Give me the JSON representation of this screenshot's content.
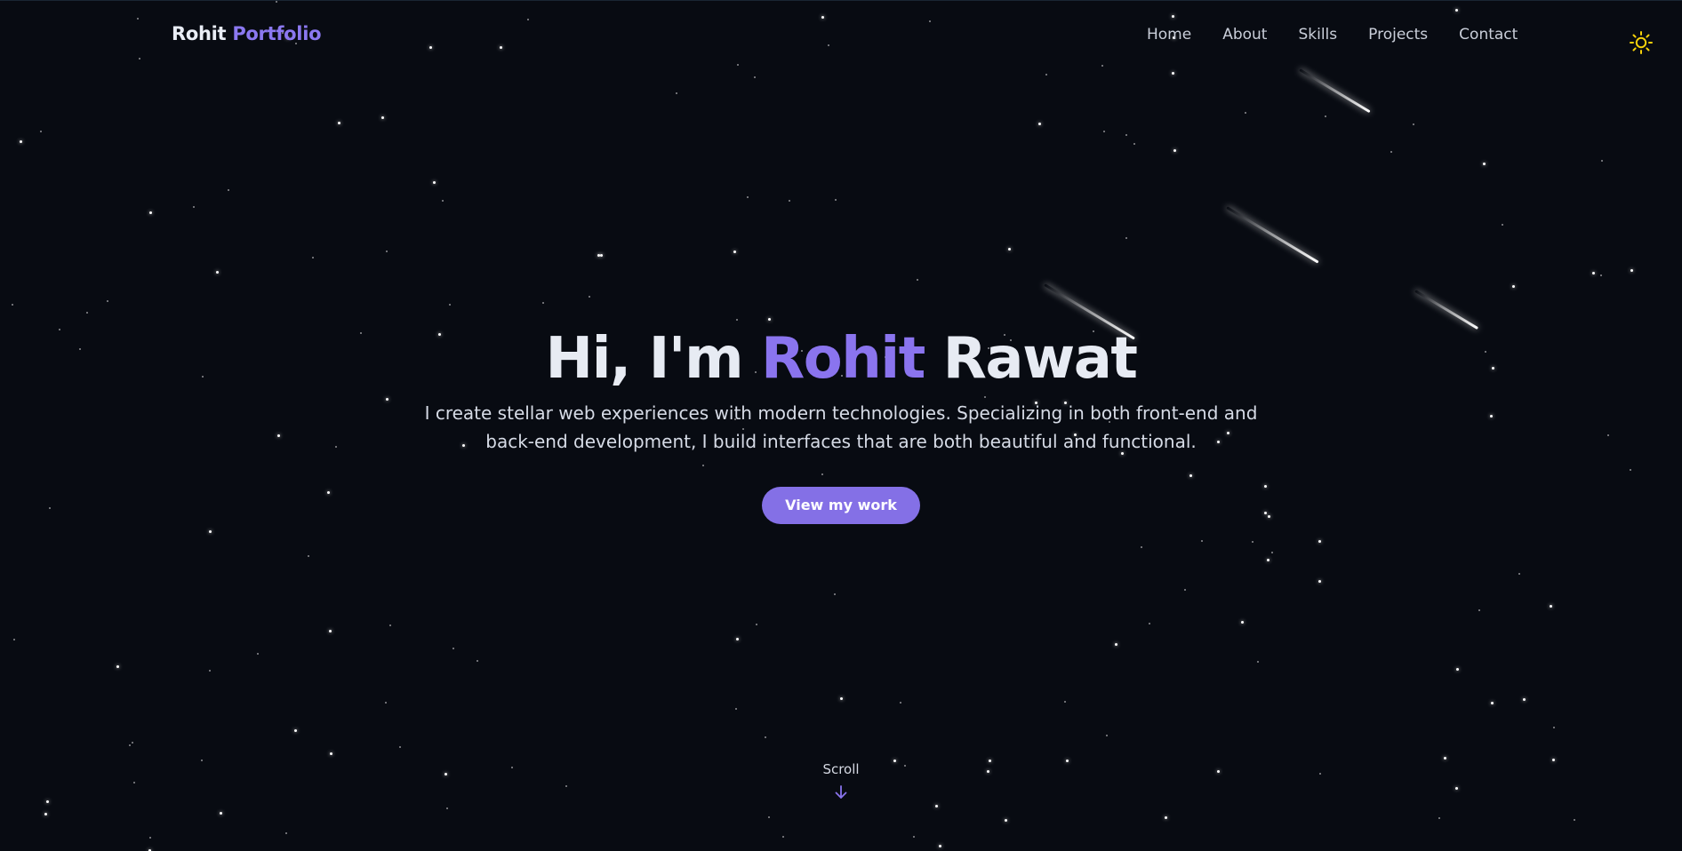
{
  "header": {
    "logo_first": "Rohit",
    "logo_second": "Portfolio",
    "nav": [
      "Home",
      "About",
      "Skills",
      "Projects",
      "Contact"
    ]
  },
  "theme_toggle": {
    "icon": "sun-icon",
    "color": "#f5d10a"
  },
  "hero": {
    "title_prefix": "Hi, I'm",
    "title_first_name": "Rohit",
    "title_last_name": "Rawat",
    "description": "I create stellar web experiences with modern technologies. Specializing in both front-end and back-end development, I build interfaces that are both beautiful and functional.",
    "cta_label": "View my work"
  },
  "scroll": {
    "label": "Scroll",
    "icon": "arrow-down-icon"
  },
  "colors": {
    "background": "#080b12",
    "accent": "#8a74ee",
    "button": "#8470e6",
    "text": "#e7ebf3"
  }
}
